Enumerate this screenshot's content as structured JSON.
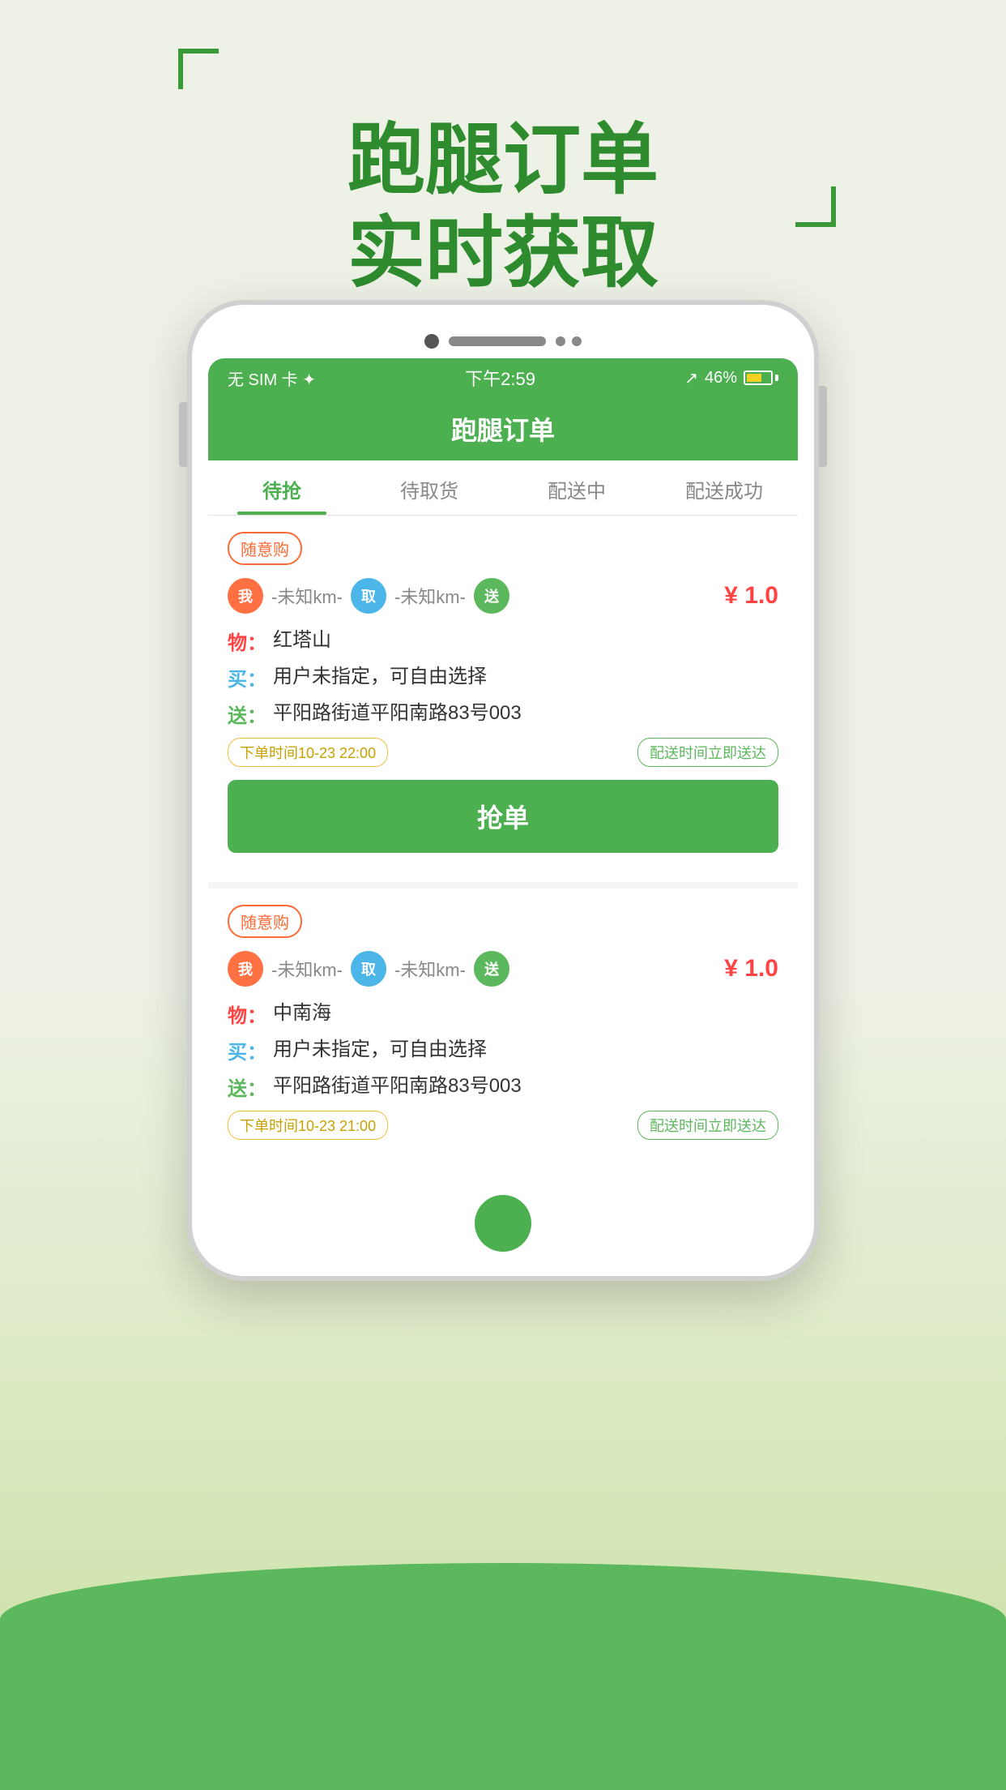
{
  "background": {
    "color": "#e8ede0"
  },
  "header": {
    "title_line1": "跑腿订单",
    "title_line2": "实时获取"
  },
  "phone": {
    "status_bar": {
      "left": "无 SIM 卡 ✦",
      "center": "下午2:59",
      "right_text": "46%",
      "signal_icon": "signal",
      "battery_icon": "battery"
    },
    "app_title": "跑腿订单",
    "tabs": [
      {
        "label": "待抢",
        "active": true
      },
      {
        "label": "待取货",
        "active": false
      },
      {
        "label": "配送中",
        "active": false
      },
      {
        "label": "配送成功",
        "active": false
      }
    ],
    "orders": [
      {
        "badge": "随意购",
        "from_pin": "我",
        "distance1": "-未知km-",
        "pickup_pin": "取",
        "distance2": "-未知km-",
        "delivery_pin": "送",
        "price": "¥ 1.0",
        "goods": "红塔山",
        "goods_label": "物：",
        "buyer_note": "用户未指定，可自由选择",
        "buyer_label": "买：",
        "address": "平阳路街道平阳南路83号003",
        "address_label": "送：",
        "order_time": "下单时间10-23 22:00",
        "delivery_time": "配送时间立即送达",
        "grab_button": "抢单"
      },
      {
        "badge": "随意购",
        "from_pin": "我",
        "distance1": "-未知km-",
        "pickup_pin": "取",
        "distance2": "-未知km-",
        "delivery_pin": "送",
        "price": "¥ 1.0",
        "goods": "中南海",
        "goods_label": "物：",
        "buyer_note": "用户未指定，可自由选择",
        "buyer_label": "买：",
        "address": "平阳路街道平阳南路83号003",
        "address_label": "送：",
        "order_time": "下单时间10-23 21:00",
        "delivery_time": "配送时间立即送达"
      }
    ]
  }
}
